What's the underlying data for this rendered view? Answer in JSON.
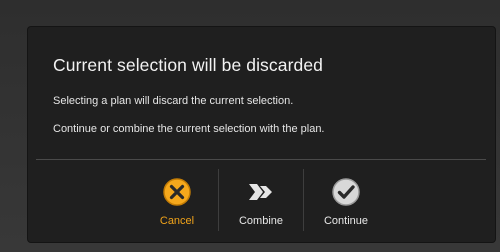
{
  "dialog": {
    "title": "Current selection will be discarded",
    "message_1": "Selecting a plan will discard the current selection.",
    "message_2": "Continue or combine the current selection with the plan."
  },
  "actions": {
    "cancel": {
      "label": "Cancel",
      "icon": "close-circle-icon",
      "color": "#f0a31a"
    },
    "combine": {
      "label": "Combine",
      "icon": "merge-arrow-icon"
    },
    "continue": {
      "label": "Continue",
      "icon": "check-circle-icon"
    }
  },
  "colors": {
    "dialog_background": "#1f1f1f",
    "text": "#f2f2f2",
    "accent": "#f0a31a"
  }
}
